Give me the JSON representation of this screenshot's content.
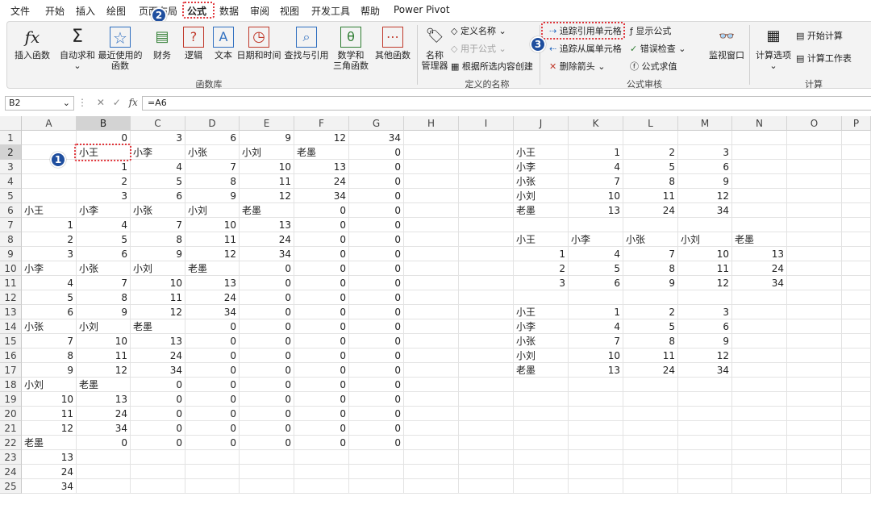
{
  "menus": [
    "文件",
    "开始",
    "插入",
    "绘图",
    "页面布局",
    "公式",
    "数据",
    "审阅",
    "视图",
    "开发工具",
    "帮助",
    "Power Pivot"
  ],
  "active_menu_index": 5,
  "ribbon": {
    "insert_function": "插入函数",
    "autosum": "自动求和",
    "recent_1": "最近使用的",
    "recent_2": "函数",
    "finance": "财务",
    "logic": "逻辑",
    "text": "文本",
    "datetime": "日期和时间",
    "lookup": "查找与引用",
    "math_1": "数学和",
    "math_2": "三角函数",
    "other": "其他函数",
    "group_library": "函数库",
    "name_mgr_1": "名称",
    "name_mgr_2": "管理器",
    "define_name": "定义名称",
    "use_in_formula": "用于公式",
    "create_from_sel": "根据所选内容创建",
    "group_names": "定义的名称",
    "trace_precedents": "追踪引用单元格",
    "trace_dependents": "追踪从属单元格",
    "remove_arrows": "删除箭头",
    "show_formulas": "显示公式",
    "error_check": "错误检查",
    "eval_formula": "公式求值",
    "watch_window": "监视窗口",
    "group_audit": "公式审核",
    "calc_options": "计算选项",
    "calc_now": "开始计算",
    "calc_sheet": "计算工作表",
    "group_calc": "计算",
    "badge_1": "1",
    "badge_2": "2",
    "badge_3": "3"
  },
  "formula_bar": {
    "name_box": "B2",
    "formula": "=A6",
    "fx": "fx"
  },
  "columns": [
    "A",
    "B",
    "C",
    "D",
    "E",
    "F",
    "G",
    "H",
    "I",
    "J",
    "K",
    "L",
    "M",
    "N",
    "O",
    "P"
  ],
  "selected_column": "B",
  "selected_row": 2,
  "cells": [
    [
      "",
      "0",
      "3",
      "6",
      "9",
      "12",
      "34",
      "",
      "",
      "",
      "",
      "",
      "",
      "",
      "",
      ""
    ],
    [
      "",
      "小王",
      "小李",
      "小张",
      "小刘",
      "老墨",
      "0",
      "",
      "",
      "小王",
      "1",
      "2",
      "3",
      "",
      "",
      ""
    ],
    [
      "",
      "1",
      "4",
      "7",
      "10",
      "13",
      "0",
      "",
      "",
      "小李",
      "4",
      "5",
      "6",
      "",
      "",
      ""
    ],
    [
      "",
      "2",
      "5",
      "8",
      "11",
      "24",
      "0",
      "",
      "",
      "小张",
      "7",
      "8",
      "9",
      "",
      "",
      ""
    ],
    [
      "",
      "3",
      "6",
      "9",
      "12",
      "34",
      "0",
      "",
      "",
      "小刘",
      "10",
      "11",
      "12",
      "",
      "",
      ""
    ],
    [
      "小王",
      "小李",
      "小张",
      "小刘",
      "老墨",
      "0",
      "0",
      "",
      "",
      "老墨",
      "13",
      "24",
      "34",
      "",
      "",
      ""
    ],
    [
      "1",
      "4",
      "7",
      "10",
      "13",
      "0",
      "0",
      "",
      "",
      "",
      "",
      "",
      "",
      "",
      "",
      ""
    ],
    [
      "2",
      "5",
      "8",
      "11",
      "24",
      "0",
      "0",
      "",
      "",
      "小王",
      "小李",
      "小张",
      "小刘",
      "老墨",
      "",
      ""
    ],
    [
      "3",
      "6",
      "9",
      "12",
      "34",
      "0",
      "0",
      "",
      "",
      "1",
      "4",
      "7",
      "10",
      "13",
      "",
      ""
    ],
    [
      "小李",
      "小张",
      "小刘",
      "老墨",
      "0",
      "0",
      "0",
      "",
      "",
      "2",
      "5",
      "8",
      "11",
      "24",
      "",
      ""
    ],
    [
      "4",
      "7",
      "10",
      "13",
      "0",
      "0",
      "0",
      "",
      "",
      "3",
      "6",
      "9",
      "12",
      "34",
      "",
      ""
    ],
    [
      "5",
      "8",
      "11",
      "24",
      "0",
      "0",
      "0",
      "",
      "",
      "",
      "",
      "",
      "",
      "",
      "",
      ""
    ],
    [
      "6",
      "9",
      "12",
      "34",
      "0",
      "0",
      "0",
      "",
      "",
      "小王",
      "1",
      "2",
      "3",
      "",
      "",
      ""
    ],
    [
      "小张",
      "小刘",
      "老墨",
      "0",
      "0",
      "0",
      "0",
      "",
      "",
      "小李",
      "4",
      "5",
      "6",
      "",
      "",
      ""
    ],
    [
      "7",
      "10",
      "13",
      "0",
      "0",
      "0",
      "0",
      "",
      "",
      "小张",
      "7",
      "8",
      "9",
      "",
      "",
      ""
    ],
    [
      "8",
      "11",
      "24",
      "0",
      "0",
      "0",
      "0",
      "",
      "",
      "小刘",
      "10",
      "11",
      "12",
      "",
      "",
      ""
    ],
    [
      "9",
      "12",
      "34",
      "0",
      "0",
      "0",
      "0",
      "",
      "",
      "老墨",
      "13",
      "24",
      "34",
      "",
      "",
      ""
    ],
    [
      "小刘",
      "老墨",
      "0",
      "0",
      "0",
      "0",
      "0",
      "",
      "",
      "",
      "",
      "",
      "",
      "",
      "",
      ""
    ],
    [
      "10",
      "13",
      "0",
      "0",
      "0",
      "0",
      "0",
      "",
      "",
      "",
      "",
      "",
      "",
      "",
      "",
      ""
    ],
    [
      "11",
      "24",
      "0",
      "0",
      "0",
      "0",
      "0",
      "",
      "",
      "",
      "",
      "",
      "",
      "",
      "",
      ""
    ],
    [
      "12",
      "34",
      "0",
      "0",
      "0",
      "0",
      "0",
      "",
      "",
      "",
      "",
      "",
      "",
      "",
      "",
      ""
    ],
    [
      "老墨",
      "0",
      "0",
      "0",
      "0",
      "0",
      "0",
      "",
      "",
      "",
      "",
      "",
      "",
      "",
      "",
      ""
    ],
    [
      "13",
      "",
      "",
      "",
      "",
      "",
      "",
      "",
      "",
      "",
      "",
      "",
      "",
      "",
      "",
      ""
    ],
    [
      "24",
      "",
      "",
      "",
      "",
      "",
      "",
      "",
      "",
      "",
      "",
      "",
      "",
      "",
      "",
      ""
    ],
    [
      "34",
      "",
      "",
      "",
      "",
      "",
      "",
      "",
      "",
      "",
      "",
      "",
      "",
      "",
      "",
      ""
    ]
  ],
  "accent": "#e0353b",
  "badge_color": "#1f4e9e"
}
